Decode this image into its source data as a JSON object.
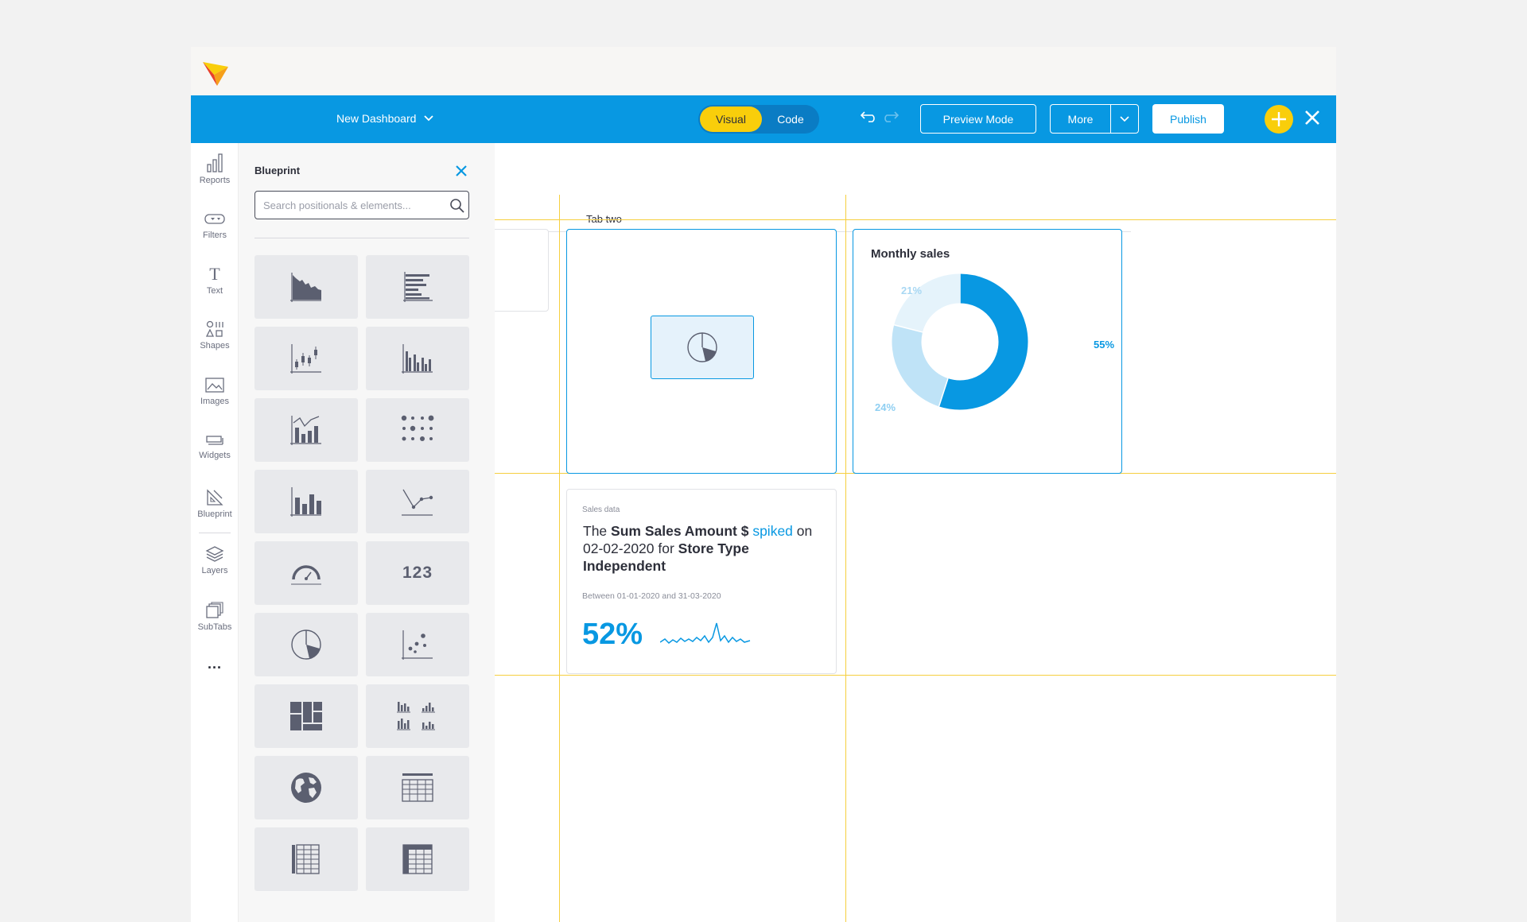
{
  "header": {
    "dashboard_title": "New Dashboard",
    "mode_toggle": {
      "active": "Visual",
      "inactive": "Code"
    },
    "preview_label": "Preview Mode",
    "more_label": "More",
    "publish_label": "Publish"
  },
  "sidebar": {
    "items": [
      {
        "label": "Reports",
        "icon": "bar-chart-icon"
      },
      {
        "label": "Filters",
        "icon": "filter-icon"
      },
      {
        "label": "Text",
        "icon": "text-icon"
      },
      {
        "label": "Shapes",
        "icon": "shapes-icon"
      },
      {
        "label": "Images",
        "icon": "image-icon"
      },
      {
        "label": "Widgets",
        "icon": "widget-icon"
      },
      {
        "label": "Blueprint",
        "icon": "blueprint-icon"
      },
      {
        "label": "Layers",
        "icon": "layers-icon"
      },
      {
        "label": "SubTabs",
        "icon": "subtabs-icon"
      }
    ],
    "more": "..."
  },
  "panel": {
    "title": "Blueprint",
    "search_placeholder": "Search positionals & elements...",
    "tiles": [
      "area-chart-icon",
      "horizontal-bar-icon",
      "candlestick-icon",
      "grouped-bar-icon",
      "combo-chart-icon",
      "dot-matrix-icon",
      "bar-chart-icon",
      "line-chart-icon",
      "gauge-icon",
      "number-tile",
      "pie-chart-icon",
      "scatter-icon",
      "treemap-icon",
      "small-multiples-icon",
      "globe-icon",
      "table-icon",
      "pivot-table-icon",
      "crosstab-icon"
    ],
    "number_tile_text": "123"
  },
  "canvas": {
    "tabs": [
      "Tab two"
    ],
    "monthly_sales": {
      "title": "Monthly sales",
      "segments": [
        {
          "label": "55%",
          "value": 55,
          "color": "#0898e2"
        },
        {
          "label": "24%",
          "value": 24,
          "color": "#bfe3f7"
        },
        {
          "label": "21%",
          "value": 21,
          "color": "#e5f3fb"
        }
      ]
    },
    "sales_card": {
      "kicker": "Sales data",
      "text_pre": "The ",
      "metric": "Sum Sales Amount $",
      "event": "spiked",
      "text_on": " on 02-02-2020 for ",
      "dimension": "Store Type Independent",
      "range": "Between 01-01-2020 and 31-03-2020",
      "percent": "52%"
    }
  },
  "colors": {
    "primary": "#0898e2",
    "accent": "#f9ce0b",
    "guides": "#f6cf3f"
  }
}
